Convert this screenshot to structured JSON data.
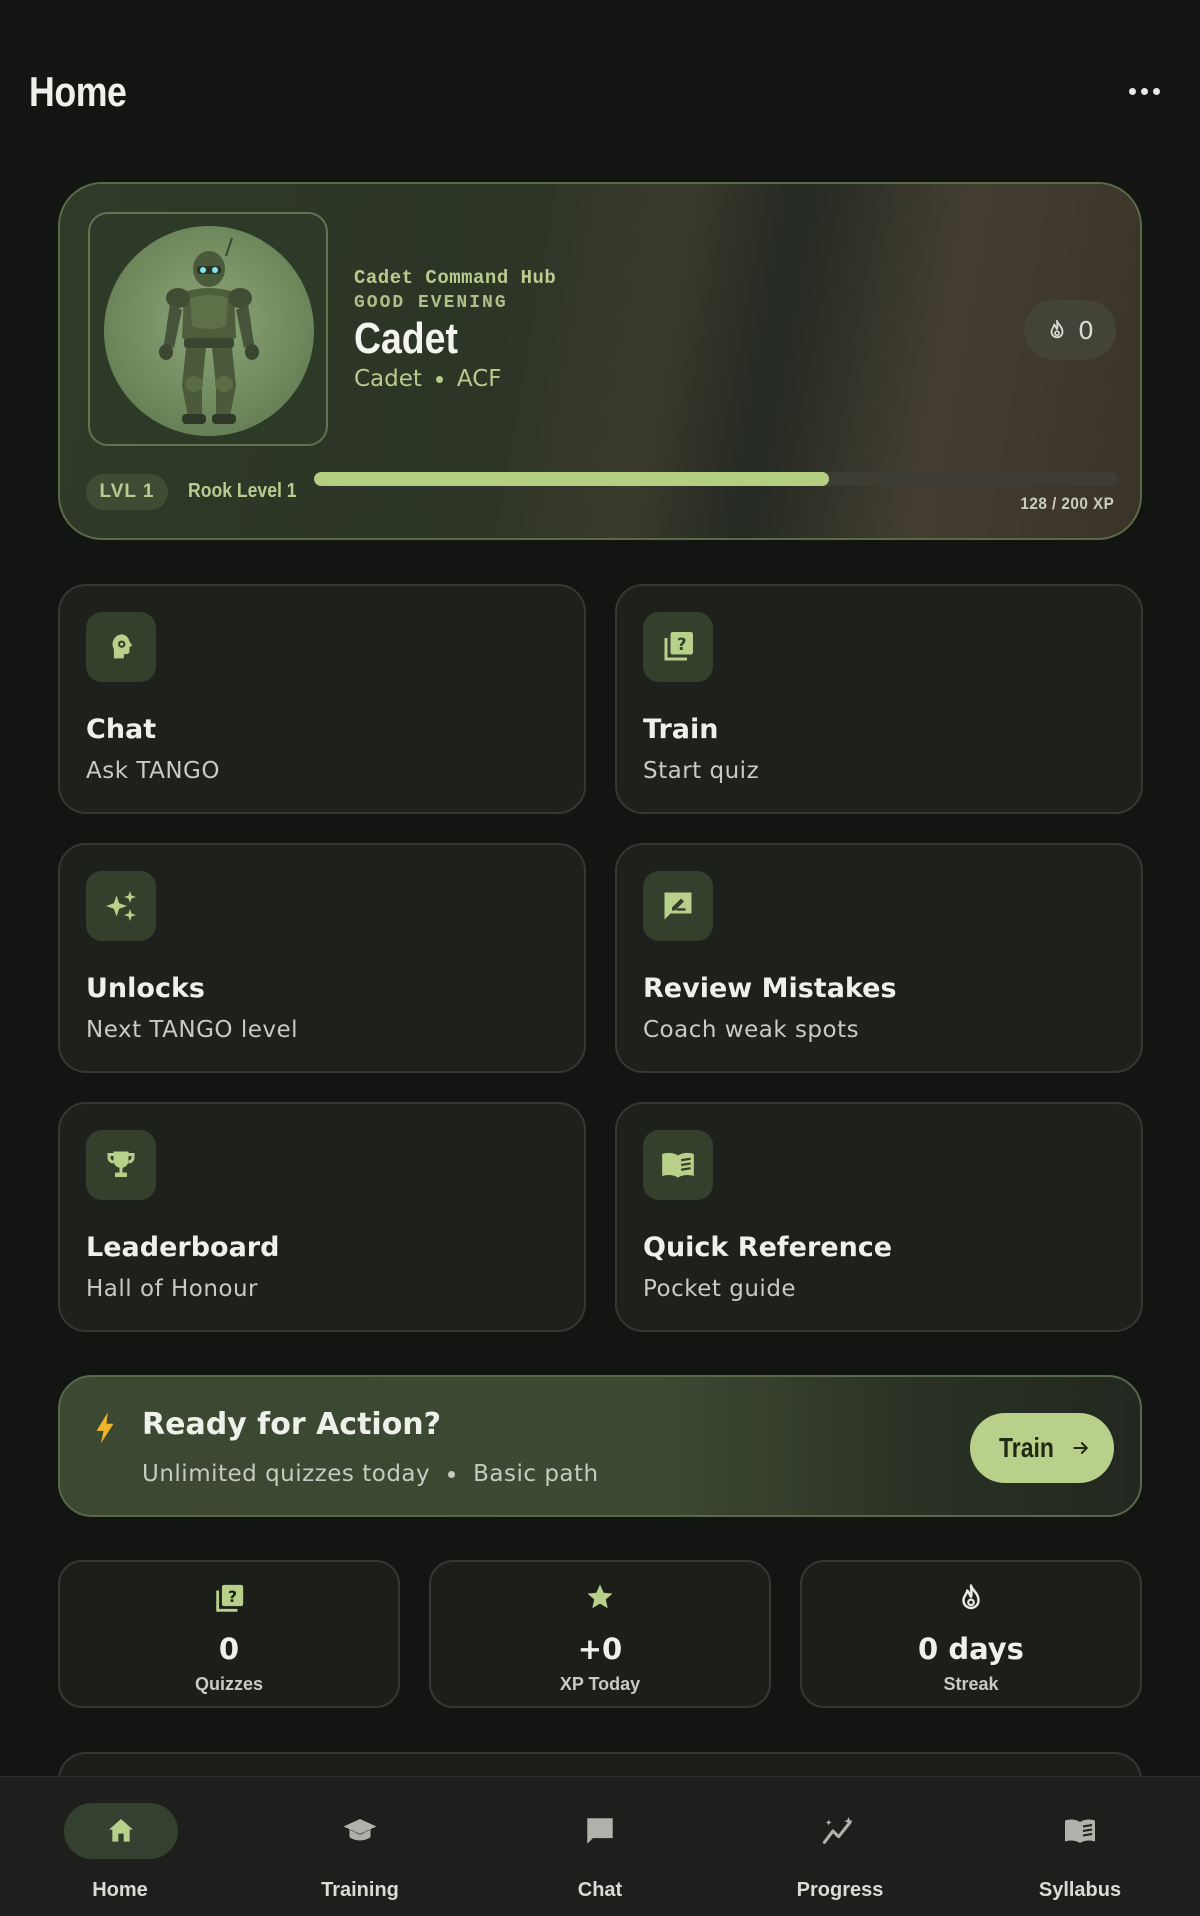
{
  "header": {
    "title": "Home",
    "more_icon": "more-horizontal-icon"
  },
  "hero": {
    "hub_label": "Cadet Command Hub",
    "greeting": "GOOD EVENING",
    "name": "Cadet",
    "role": "Cadet",
    "unit": "ACF",
    "streak_count": "0",
    "level_badge": "LVL 1",
    "rank_label": "Rook Level 1",
    "xp_current": 128,
    "xp_max": 200,
    "xp_text": "128 / 200 XP",
    "xp_progress": 0.64
  },
  "tiles": [
    {
      "title": "Chat",
      "subtitle": "Ask TANGO",
      "icon": "brain-head-icon"
    },
    {
      "title": "Train",
      "subtitle": "Start quiz",
      "icon": "quiz-icon"
    },
    {
      "title": "Unlocks",
      "subtitle": "Next TANGO level",
      "icon": "sparkle-icon"
    },
    {
      "title": "Review Mistakes",
      "subtitle": "Coach weak spots",
      "icon": "review-edit-icon"
    },
    {
      "title": "Leaderboard",
      "subtitle": "Hall of Honour",
      "icon": "trophy-icon"
    },
    {
      "title": "Quick Reference",
      "subtitle": "Pocket guide",
      "icon": "book-icon"
    }
  ],
  "cta": {
    "title": "Ready for Action?",
    "sub1": "Unlimited quizzes today",
    "sub2": "Basic path",
    "button_label": "Train"
  },
  "stats": [
    {
      "value": "0",
      "label": "Quizzes",
      "icon": "quiz-icon"
    },
    {
      "value": "+0",
      "label": "XP Today",
      "icon": "star-icon"
    },
    {
      "value": "0 days",
      "label": "Streak",
      "icon": "flame-icon"
    }
  ],
  "nav": [
    {
      "label": "Home",
      "icon": "home-icon",
      "active": true
    },
    {
      "label": "Training",
      "icon": "graduation-cap-icon",
      "active": false
    },
    {
      "label": "Chat",
      "icon": "chat-bubble-icon",
      "active": false
    },
    {
      "label": "Progress",
      "icon": "trend-chart-icon",
      "active": false
    },
    {
      "label": "Syllabus",
      "icon": "book-icon",
      "active": false
    }
  ],
  "colors": {
    "accent": "#b8d08a",
    "background": "#131513",
    "card": "#1e201c",
    "bolt": "#f0b429"
  }
}
